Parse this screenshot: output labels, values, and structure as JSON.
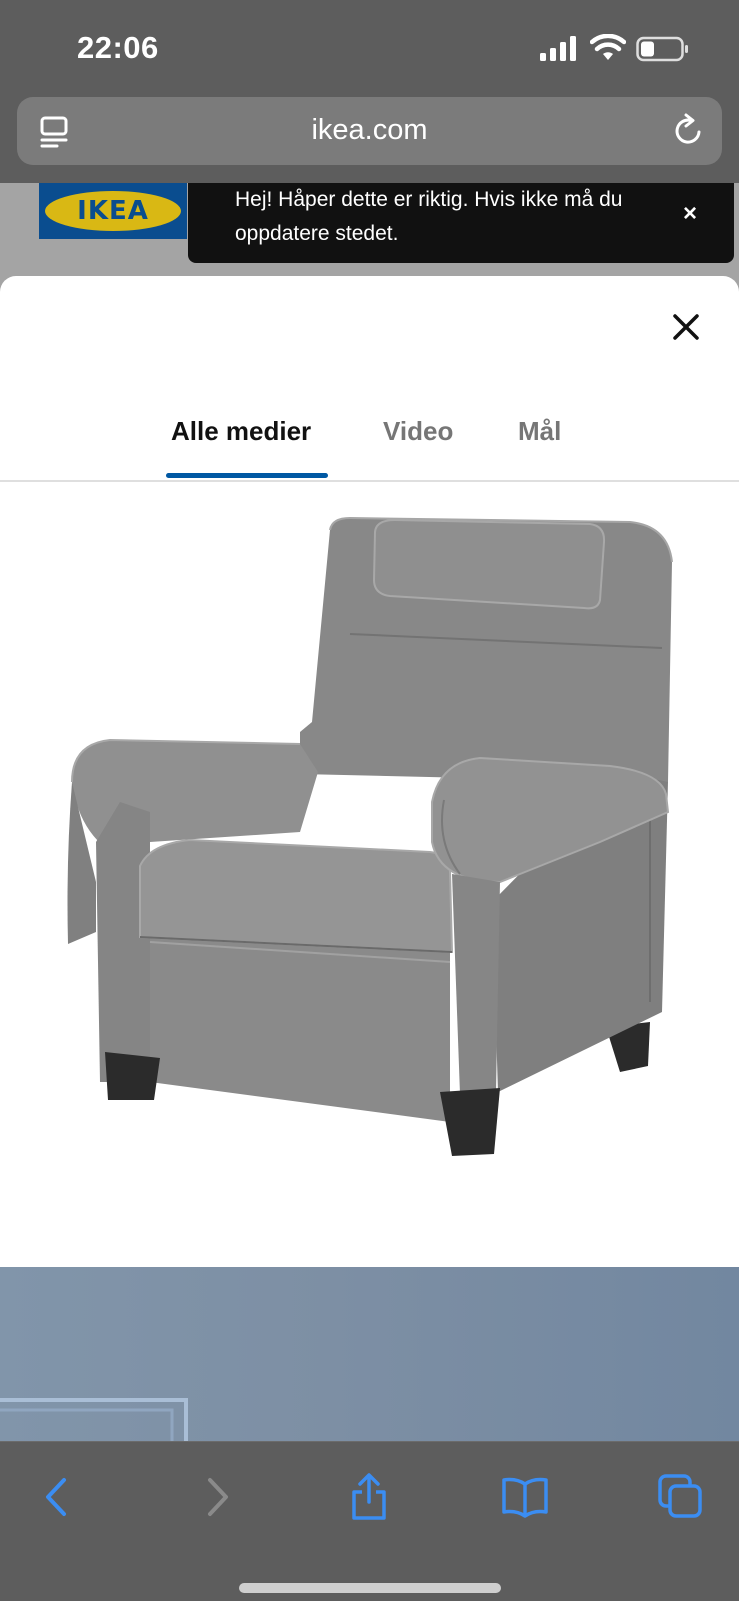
{
  "status_bar": {
    "time": "22:06"
  },
  "browser": {
    "url": "ikea.com",
    "icons": [
      "reader-icon",
      "reload-icon"
    ],
    "toolbar": [
      "back-icon",
      "forward-icon",
      "share-icon",
      "bookmarks-icon",
      "tabs-icon"
    ]
  },
  "page": {
    "logo_text": "IKEA",
    "toast": {
      "message": "Hej! Håper dette er riktig. Hvis ikke må du oppdatere stedet.",
      "close_glyph": "×"
    }
  },
  "media_modal": {
    "tabs": [
      {
        "label": "Alle medier",
        "active": true
      },
      {
        "label": "Video",
        "active": false
      },
      {
        "label": "Mål",
        "active": false
      }
    ]
  },
  "colors": {
    "accent": "#0058a3",
    "ios_blue": "#3b8df2",
    "chair": "#8a8a8a"
  }
}
